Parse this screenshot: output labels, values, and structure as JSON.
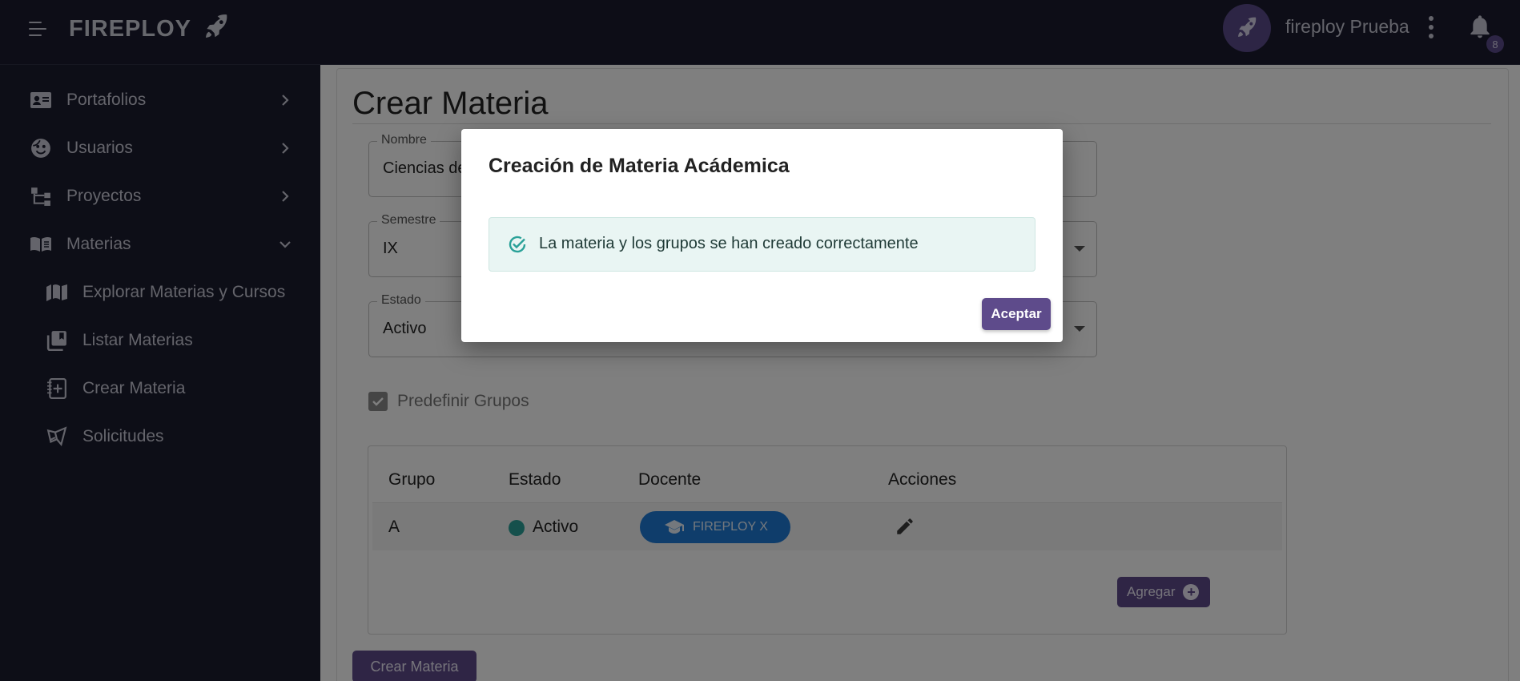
{
  "app": {
    "brand": "FIREPLOY"
  },
  "header": {
    "username": "fireploy Prueba",
    "notifications_count": "8"
  },
  "sidebar": {
    "items": [
      {
        "label": "Portafolios",
        "icon": "id-card-icon"
      },
      {
        "label": "Usuarios",
        "icon": "face-icon"
      },
      {
        "label": "Proyectos",
        "icon": "hierarchy-icon"
      },
      {
        "label": "Materias",
        "icon": "book-icon"
      }
    ],
    "subitems": [
      {
        "label": "Explorar Materias y Cursos",
        "icon": "map-book-icon"
      },
      {
        "label": "Listar Materias",
        "icon": "library-icon"
      },
      {
        "label": "Crear Materia",
        "icon": "add-notebook-icon"
      },
      {
        "label": "Solicitudes",
        "icon": "send-icon"
      }
    ]
  },
  "form": {
    "title": "Crear Materia",
    "nombre": {
      "label": "Nombre",
      "value": "Ciencias de"
    },
    "semestre": {
      "label": "Semestre",
      "value": "IX"
    },
    "estado": {
      "label": "Estado",
      "value": "Activo"
    },
    "predefinir_label": "Predefinir Grupos",
    "table": {
      "headers": [
        "Grupo",
        "Estado",
        "Docente",
        "Acciones"
      ],
      "rows": [
        {
          "grupo": "A",
          "estado": "Activo",
          "docente": "FIREPLOY X"
        }
      ]
    },
    "add_label": "Agregar",
    "submit_label": "Crear Materia"
  },
  "dialog": {
    "title": "Creación de Materia Acádemica",
    "message": "La materia y los grupos se han creado correctamente",
    "accept_label": "Aceptar"
  },
  "colors": {
    "sidebar_bg": "#1b1d2e",
    "accent": "#5e4b8b",
    "chip": "#1e7bd6",
    "success": "#2aa198"
  }
}
